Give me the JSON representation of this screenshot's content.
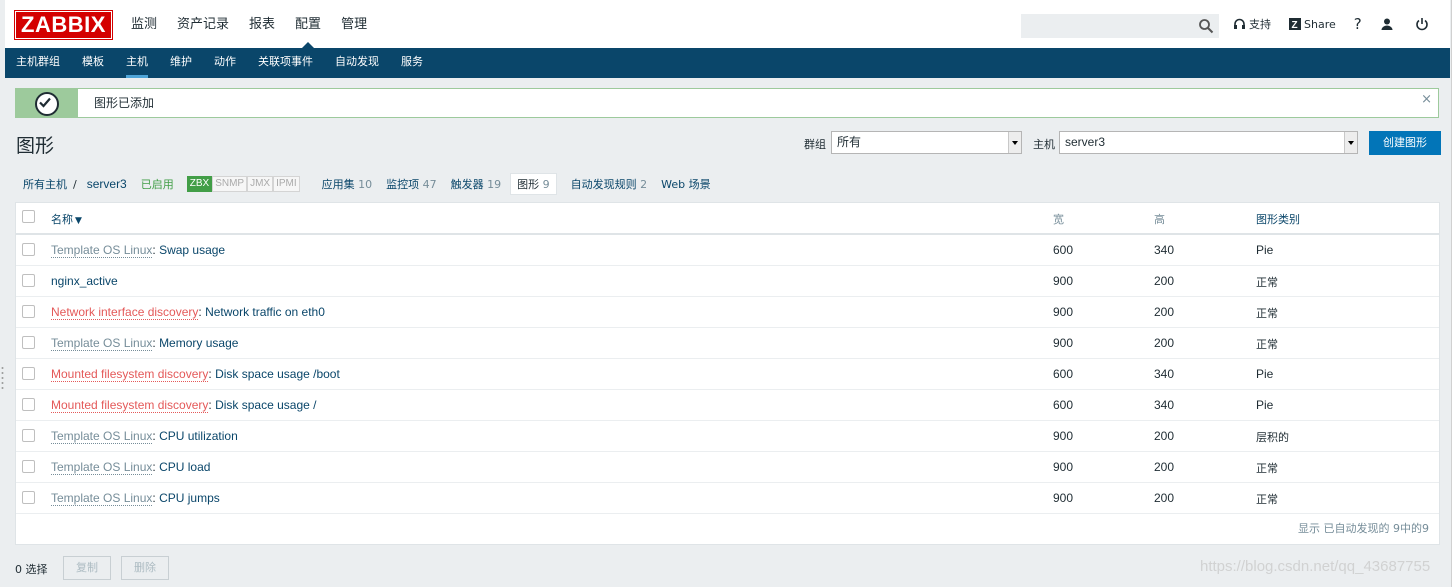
{
  "header": {
    "logo": "ZABBIX",
    "menu": [
      "监测",
      "资产记录",
      "报表",
      "配置",
      "管理"
    ],
    "selected_menu": 3,
    "search_placeholder": "",
    "support_label": "支持",
    "share_label": "Share",
    "help_label": "?"
  },
  "submenu": {
    "items": [
      "主机群组",
      "模板",
      "主机",
      "维护",
      "动作",
      "关联项事件",
      "自动发现",
      "服务"
    ],
    "selected": 2
  },
  "message": {
    "text": "图形已添加",
    "close": "×"
  },
  "page": {
    "title": "图形",
    "group_label": "群组",
    "group_value": "所有",
    "host_label": "主机",
    "host_value": "server3",
    "create_button": "创建图形"
  },
  "hostnav": {
    "all_hosts": "所有主机",
    "separator": "/",
    "host": "server3",
    "status": "已启用",
    "availability": [
      "ZBX",
      "SNMP",
      "JMX",
      "IPMI"
    ],
    "applications": {
      "label": "应用集",
      "count": "10"
    },
    "items": {
      "label": "监控项",
      "count": "47"
    },
    "triggers": {
      "label": "触发器",
      "count": "19"
    },
    "graphs": {
      "label": "图形",
      "count": "9"
    },
    "discovery": {
      "label": "自动发现规则",
      "count": "2"
    },
    "web": {
      "label": "Web 场景"
    }
  },
  "table": {
    "headers": {
      "name": "名称",
      "sort_arrow": "▼",
      "width": "宽",
      "height": "高",
      "graph_type": "图形类别"
    },
    "rows": [
      {
        "prefix": "Template OS Linux",
        "prefix_type": "template",
        "name": "Swap usage",
        "width": "600",
        "height": "340",
        "type": "Pie"
      },
      {
        "prefix": "",
        "prefix_type": "",
        "name": "nginx_active",
        "width": "900",
        "height": "200",
        "type": "正常"
      },
      {
        "prefix": "Network interface discovery",
        "prefix_type": "discovery",
        "name": "Network traffic on eth0",
        "width": "900",
        "height": "200",
        "type": "正常"
      },
      {
        "prefix": "Template OS Linux",
        "prefix_type": "template",
        "name": "Memory usage",
        "width": "900",
        "height": "200",
        "type": "正常"
      },
      {
        "prefix": "Mounted filesystem discovery",
        "prefix_type": "discovery",
        "name": "Disk space usage /boot",
        "width": "600",
        "height": "340",
        "type": "Pie"
      },
      {
        "prefix": "Mounted filesystem discovery",
        "prefix_type": "discovery",
        "name": "Disk space usage /",
        "width": "600",
        "height": "340",
        "type": "Pie"
      },
      {
        "prefix": "Template OS Linux",
        "prefix_type": "template",
        "name": "CPU utilization",
        "width": "900",
        "height": "200",
        "type": "层积的"
      },
      {
        "prefix": "Template OS Linux",
        "prefix_type": "template",
        "name": "CPU load",
        "width": "900",
        "height": "200",
        "type": "正常"
      },
      {
        "prefix": "Template OS Linux",
        "prefix_type": "template",
        "name": "CPU jumps",
        "width": "900",
        "height": "200",
        "type": "正常"
      }
    ],
    "footer": "显示 已自动发现的 9中的9"
  },
  "actions": {
    "selected": "0 选择",
    "copy": "复制",
    "delete": "删除"
  },
  "watermark": "https://blog.csdn.net/qq_43687755"
}
